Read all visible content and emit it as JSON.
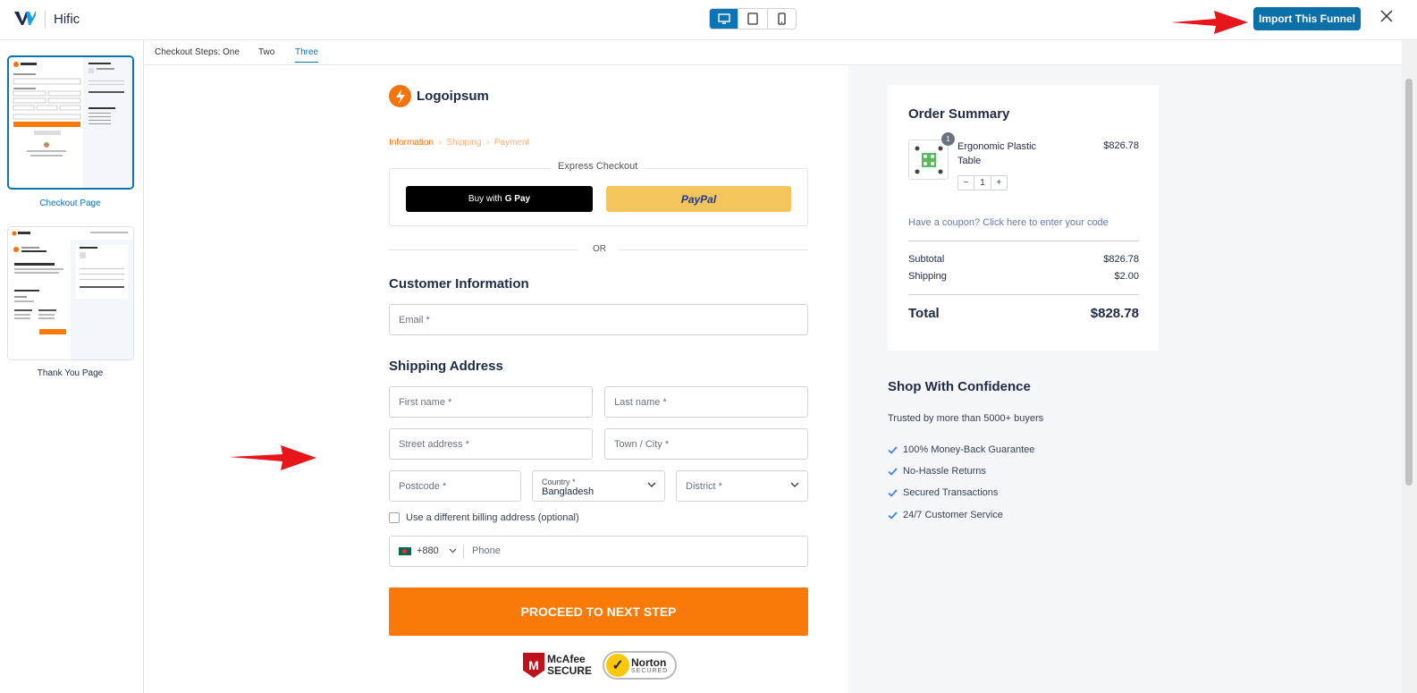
{
  "app": {
    "title": "Hific"
  },
  "topbar": {
    "import_label": "Import This Funnel"
  },
  "sidebar": {
    "pages": [
      {
        "label": "Checkout Page"
      },
      {
        "label": "Thank You Page"
      }
    ]
  },
  "steps": {
    "prefix": "Checkout Steps:",
    "items": [
      "One",
      "Two",
      "Three"
    ]
  },
  "checkout": {
    "brand": "Logoipsum",
    "breadcrumbs": [
      "Information",
      "Shipping",
      "Payment"
    ],
    "express_label": "Express Checkout",
    "gpay_prefix": "Buy with",
    "gpay_brand": "G Pay",
    "paypal_label": "PayPal",
    "or_label": "OR",
    "customer_title": "Customer Information",
    "email_placeholder": "Email *",
    "shipping_title": "Shipping Address",
    "first_name": "First name *",
    "last_name": "Last name *",
    "street": "Street address *",
    "town": "Town / City *",
    "postcode": "Postcode *",
    "country_label": "Country *",
    "country_value": "Bangladesh",
    "district": "District *",
    "billing_label": "Use a different billing address (optional)",
    "dial_code": "+880",
    "phone_placeholder": "Phone",
    "proceed_label": "PROCEED TO NEXT STEP",
    "badges": {
      "mcafee_top": "McAfee",
      "mcafee_bottom": "SECURE",
      "norton_top": "Norton",
      "norton_bottom": "SECURED"
    }
  },
  "summary": {
    "title": "Order Summary",
    "product_name": "Ergonomic Plastic Table",
    "product_price": "$826.78",
    "qty": "1",
    "qty_badge": "1",
    "coupon": "Have a coupon? Click here to enter your code",
    "subtotal_label": "Subtotal",
    "subtotal": "$826.78",
    "shipping_label": "Shipping",
    "shipping": "$2.00",
    "total_label": "Total",
    "total": "$828.78"
  },
  "confidence": {
    "title": "Shop With Confidence",
    "subtitle": "Trusted by more than 5000+ buyers",
    "items": [
      "100% Money-Back Guarantee",
      "No-Hassle Returns",
      "Secured Transactions",
      "24/7 Customer Service"
    ]
  },
  "colors": {
    "accent": "#0b74b5",
    "orange": "#fa7a07",
    "paypal": "#f4c55c",
    "annotation_arrow": "#e8151b"
  }
}
